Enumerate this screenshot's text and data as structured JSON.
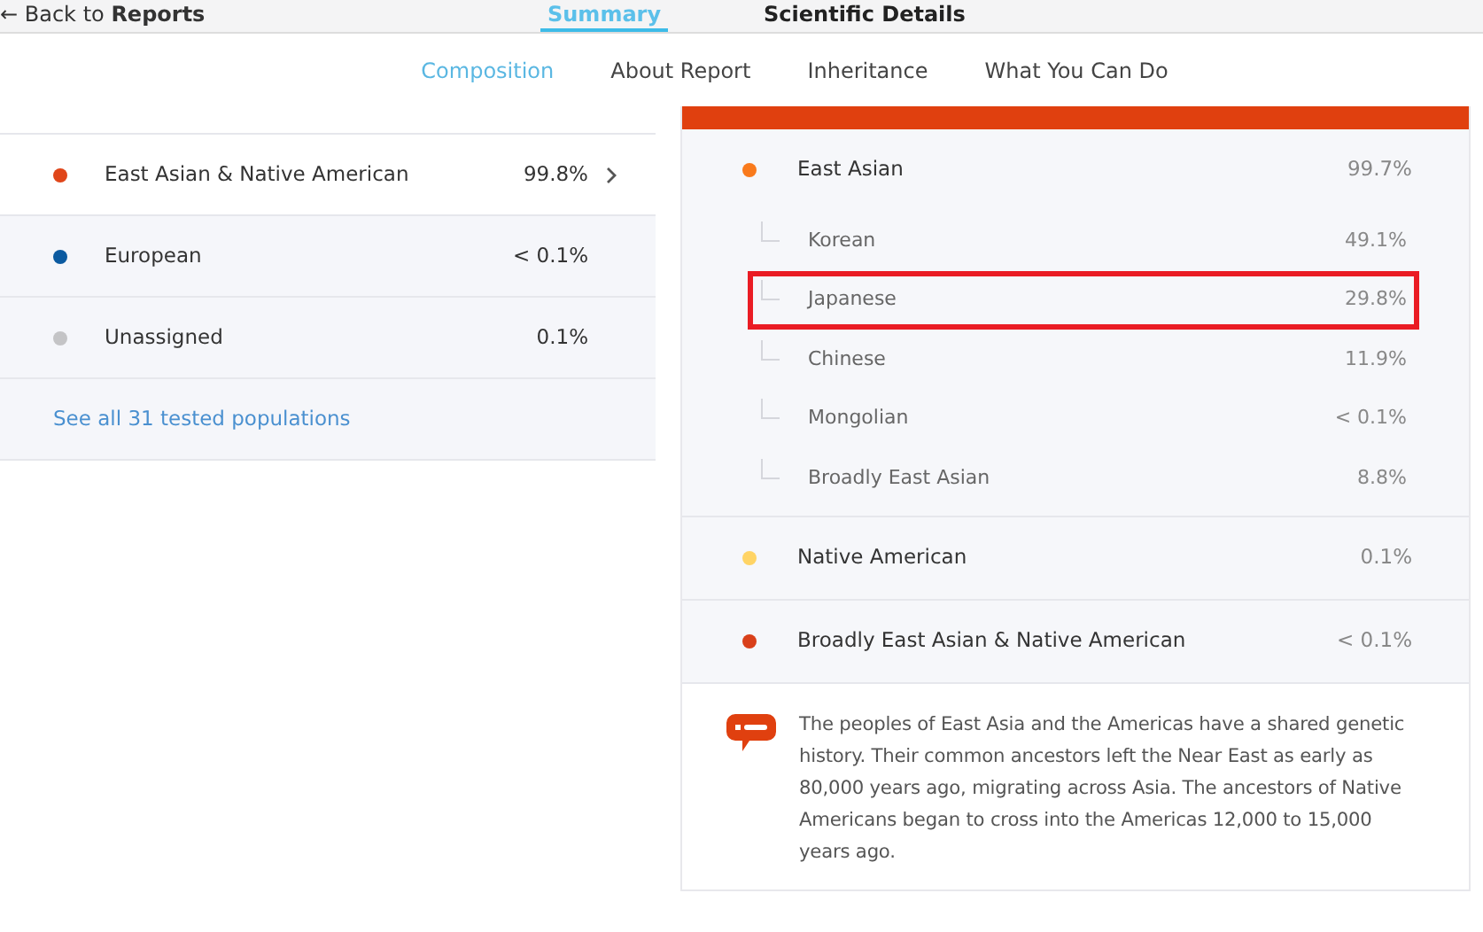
{
  "top_nav": {
    "back_link": {
      "arrow": "←",
      "prefix": "Back to ",
      "label": "Reports"
    },
    "tabs": [
      {
        "label": "Summary",
        "selected": true
      },
      {
        "label": "Scientific Details",
        "selected": false
      }
    ]
  },
  "sub_nav": [
    {
      "label": "Composition",
      "selected": true
    },
    {
      "label": "About Report",
      "selected": false
    },
    {
      "label": "Inheritance",
      "selected": false
    },
    {
      "label": "What You Can Do",
      "selected": false
    }
  ],
  "summary": {
    "rows": [
      {
        "name": "East Asian & Native American",
        "value": "99.8%",
        "color": "#e0461a",
        "selected": true
      },
      {
        "name": "European",
        "value": "< 0.1%",
        "color": "#0b5aa0",
        "selected": false
      },
      {
        "name": "Unassigned",
        "value": "0.1%",
        "color": "#c4c4c6",
        "selected": false
      }
    ],
    "link": "See all 31 tested populations"
  },
  "detail": {
    "groups": [
      {
        "name": "East Asian",
        "value": "99.7%",
        "color": "#f97a1c",
        "children": [
          {
            "name": "Korean",
            "value": "49.1%",
            "highlighted": false
          },
          {
            "name": "Japanese",
            "value": "29.8%",
            "highlighted": true
          },
          {
            "name": "Chinese",
            "value": "11.9%",
            "highlighted": false
          },
          {
            "name": "Mongolian",
            "value": "< 0.1%",
            "highlighted": false
          },
          {
            "name": "Broadly East Asian",
            "value": "8.8%",
            "highlighted": false
          }
        ]
      },
      {
        "name": "Native American",
        "value": "0.1%",
        "color": "#ffd465"
      },
      {
        "name": "Broadly East Asian & Native American",
        "value": "< 0.1%",
        "color": "#d9401a"
      }
    ],
    "note": "The peoples of East Asia and the Americas have a shared genetic history. Their common ancestors left the Near East as early as 80,000 years ago, migrating across Asia. The ancestors of Native Americans began to cross into the Americas 12,000 to 15,000 years ago."
  }
}
